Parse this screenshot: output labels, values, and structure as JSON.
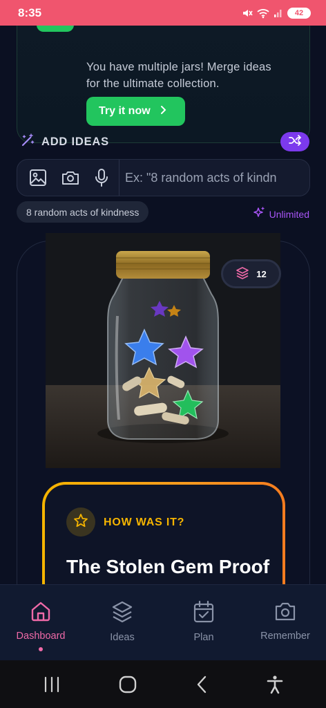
{
  "status_bar": {
    "time": "8:35",
    "battery": "42"
  },
  "merge_banner": {
    "text": "You have multiple jars! Merge ideas for the ultimate collection.",
    "button_label": "Try it now",
    "accent": "#22c55e"
  },
  "add_ideas": {
    "title": "ADD IDEAS",
    "input_placeholder": "Ex: \"8 random acts of kindn",
    "suggestion_chip": "8 random acts of kindness",
    "quota_label": "Unlimited",
    "accent": "#7c3aed"
  },
  "jar": {
    "image_description": "glass jar with origami stars and paper scrolls",
    "idea_count": "12"
  },
  "review_card": {
    "label": "HOW WAS IT?",
    "title": "The Stolen Gem Proof to Dec",
    "accent": "#f5b400"
  },
  "bottom_nav": {
    "items": [
      {
        "label": "Dashboard",
        "icon": "home-icon",
        "active": true
      },
      {
        "label": "Ideas",
        "icon": "layers-icon",
        "active": false
      },
      {
        "label": "Plan",
        "icon": "calendar-check-icon",
        "active": false
      },
      {
        "label": "Remember",
        "icon": "camera-icon",
        "active": false
      }
    ],
    "active_color": "#f06aa8"
  }
}
